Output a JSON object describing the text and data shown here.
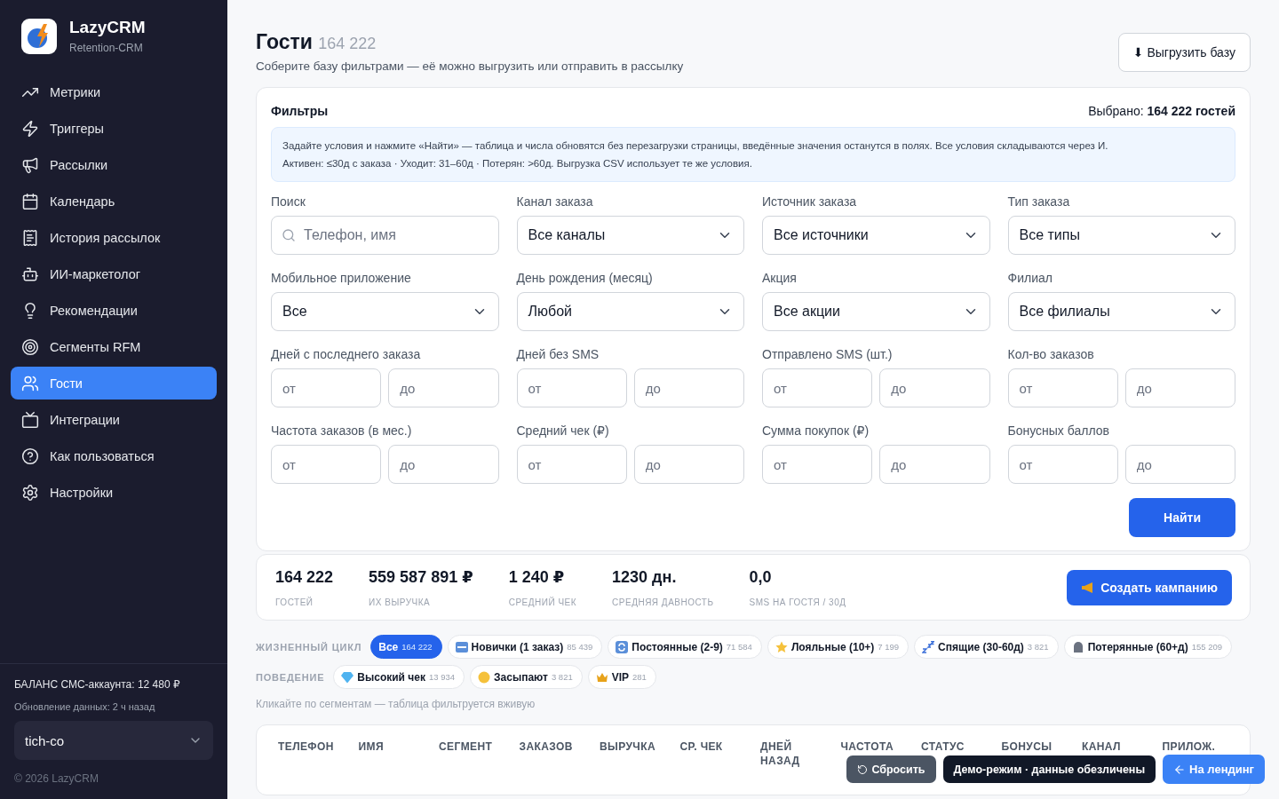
{
  "brand": {
    "name": "LazyCRM",
    "subtitle": "Retention-CRM"
  },
  "sidebar": {
    "items": [
      {
        "label": "Метрики",
        "selected": false
      },
      {
        "label": "Триггеры",
        "selected": false
      },
      {
        "label": "Рассылки",
        "selected": false
      },
      {
        "label": "Календарь",
        "selected": false
      },
      {
        "label": "История рассылок",
        "selected": false
      },
      {
        "label": "ИИ-маркетолог",
        "selected": false
      },
      {
        "label": "Рекомендации",
        "selected": false
      },
      {
        "label": "Сегменты RFM",
        "selected": false
      },
      {
        "label": "Гости",
        "selected": true
      },
      {
        "label": "Интеграции",
        "selected": false
      },
      {
        "label": "Как пользоваться",
        "selected": false
      },
      {
        "label": "Настройки",
        "selected": false
      }
    ],
    "balance": "БАЛАНС СМС-аккаунта: 12 480 ₽",
    "updated": "Обновление данных: 2 ч назад",
    "account": "tich-co",
    "copyright": "© 2026 LazyCRM"
  },
  "header": {
    "title": "Гости",
    "count": "164 222",
    "subtitle": "Соберите базу фильтрами — её можно выгрузить или отправить в рассылку",
    "export_button": "⬇ Выгрузить базу"
  },
  "filters": {
    "title": "Фильтры",
    "selected_label": "Выбрано:",
    "selected_value": "164 222 гостей",
    "info": [
      "Задайте условия и нажмите «Найти» — таблица и числа обновятся без перезагрузки страницы, введённые значения останутся в полях. Все условия складываются через И.",
      "Активен: ≤30д с заказа · Уходит: 31–60д · Потерян: >60д. Выгрузка CSV использует те же условия."
    ],
    "fields": [
      {
        "kind": "search",
        "label": "Поиск",
        "placeholder": "Телефон, имя"
      },
      {
        "kind": "select",
        "label": "Канал заказа",
        "value": "Все каналы"
      },
      {
        "kind": "select",
        "label": "Источник заказа",
        "value": "Все источники"
      },
      {
        "kind": "select",
        "label": "Тип заказа",
        "value": "Все типы"
      },
      {
        "kind": "select",
        "label": "Мобильное приложение",
        "value": "Все"
      },
      {
        "kind": "select",
        "label": "День рождения (месяц)",
        "value": "Любой"
      },
      {
        "kind": "select",
        "label": "Акция",
        "value": "Все акции"
      },
      {
        "kind": "select",
        "label": "Филиал",
        "value": "Все филиалы"
      },
      {
        "kind": "range",
        "label": "Дней с последнего заказа",
        "placeholder_from": "от",
        "placeholder_to": "до"
      },
      {
        "kind": "range",
        "label": "Дней без SMS",
        "placeholder_from": "от",
        "placeholder_to": "до"
      },
      {
        "kind": "range",
        "label": "Отправлено SMS (шт.)",
        "placeholder_from": "от",
        "placeholder_to": "до"
      },
      {
        "kind": "range",
        "label": "Кол-во заказов",
        "placeholder_from": "от",
        "placeholder_to": "до"
      },
      {
        "kind": "range",
        "label": "Частота заказов (в мес.)",
        "placeholder_from": "от",
        "placeholder_to": "до"
      },
      {
        "kind": "range",
        "label": "Средний чек (₽)",
        "placeholder_from": "от",
        "placeholder_to": "до"
      },
      {
        "kind": "range",
        "label": "Сумма покупок (₽)",
        "placeholder_from": "от",
        "placeholder_to": "до"
      },
      {
        "kind": "range",
        "label": "Бонусных баллов",
        "placeholder_from": "от",
        "placeholder_to": "до"
      }
    ],
    "find_button": "Найти"
  },
  "stats": [
    {
      "value": "164 222",
      "label": "ГОСТЕЙ"
    },
    {
      "value": "559 587 891 ₽",
      "label": "ИХ ВЫРУЧКА"
    },
    {
      "value": "1 240 ₽",
      "label": "СРЕДНИЙ ЧЕК"
    },
    {
      "value": "1230 дн.",
      "label": "СРЕДНЯЯ ДАВНОСТЬ"
    },
    {
      "value": "0,0",
      "label": "SMS НА ГОСТЯ / 30Д"
    }
  ],
  "campaign_button": "Создать кампанию",
  "segment_groups": [
    {
      "label": "ЖИЗНЕННЫЙ ЦИКЛ",
      "chips": [
        {
          "kind": "all",
          "label": "Все",
          "count": "164 222",
          "selected": true
        },
        {
          "kind": "new",
          "label": "Новички (1 заказ)",
          "count": "85 439",
          "selected": false
        },
        {
          "kind": "repeat",
          "label": "Постоянные (2-9)",
          "count": "71 584",
          "selected": false
        },
        {
          "kind": "star",
          "label": "Лояльные (10+)",
          "count": "7 199",
          "selected": false
        },
        {
          "kind": "sleep",
          "label": "Спящие (30-60д)",
          "count": "3 821",
          "selected": false
        },
        {
          "kind": "lost",
          "label": "Потерянные (60+д)",
          "count": "155 209",
          "selected": false
        }
      ]
    },
    {
      "label": "ПОВЕДЕНИЕ",
      "chips": [
        {
          "kind": "gem",
          "label": "Высокий чек",
          "count": "13 934",
          "selected": false
        },
        {
          "kind": "sleepy",
          "label": "Засыпают",
          "count": "3 821",
          "selected": false
        },
        {
          "kind": "crown",
          "label": "VIP",
          "count": "281",
          "selected": false
        }
      ]
    }
  ],
  "segments_hint": "Кликайте по сегментам — таблица фильтруется вживую",
  "table": {
    "columns": [
      "ТЕЛЕФОН",
      "ИМЯ",
      "СЕГМЕНТ",
      "ЗАКАЗОВ",
      "ВЫРУЧКА",
      "СР. ЧЕК",
      "ДНЕЙ НАЗАД",
      "ЧАСТОТА",
      "СТАТУС",
      "БОНУСЫ",
      "КАНАЛ",
      "ПРИЛОЖ."
    ]
  },
  "floating": {
    "reset": "Сбросить",
    "demo": "Демо-режим · данные обезличены",
    "landing": "На лендинг"
  }
}
